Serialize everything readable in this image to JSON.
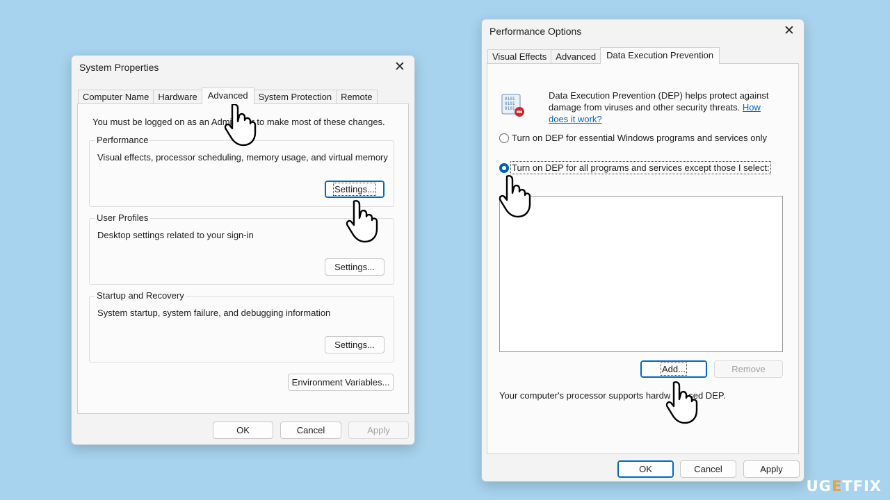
{
  "system_properties": {
    "title": "System Properties",
    "tabs": [
      {
        "label": "Computer Name"
      },
      {
        "label": "Hardware"
      },
      {
        "label": "Advanced"
      },
      {
        "label": "System Protection"
      },
      {
        "label": "Remote"
      }
    ],
    "admin_note_part1": "You must be logged on as an Admi",
    "admin_note_part2": "r to make most of these changes.",
    "performance": {
      "label": "Performance",
      "desc": "Visual effects, processor scheduling, memory usage, and virtual memory",
      "button": "Settings..."
    },
    "user_profiles": {
      "label": "User Profiles",
      "desc": "Desktop settings related to your sign-in",
      "button": "Settings..."
    },
    "startup_recovery": {
      "label": "Startup and Recovery",
      "desc": "System startup, system failure, and debugging information",
      "button": "Settings..."
    },
    "env_button": "Environment Variables...",
    "ok": "OK",
    "cancel": "Cancel",
    "apply": "Apply"
  },
  "performance_options": {
    "title": "Performance Options",
    "tabs": [
      {
        "label": "Visual Effects"
      },
      {
        "label": "Advanced"
      },
      {
        "label": "Data Execution Prevention"
      }
    ],
    "dep_desc_line1": "Data Execution Prevention (DEP) helps protect against",
    "dep_desc_line2": "damage from viruses and other security threats.",
    "how_link_part1": "How",
    "how_link_part2": "does it work?",
    "radio_essential": "Turn on DEP for essential Windows programs and services only",
    "radio_all": "Turn on DEP for all programs and services except those I select:",
    "add_button": "Add...",
    "remove_button": "Remove",
    "support_note_part1": "Your computer's processor supports hardw",
    "support_note_part2": "sed DEP.",
    "ok": "OK",
    "cancel": "Cancel",
    "apply": "Apply"
  },
  "watermark": {
    "part1": "UG",
    "accent": "E",
    "part2": "TFIX"
  }
}
